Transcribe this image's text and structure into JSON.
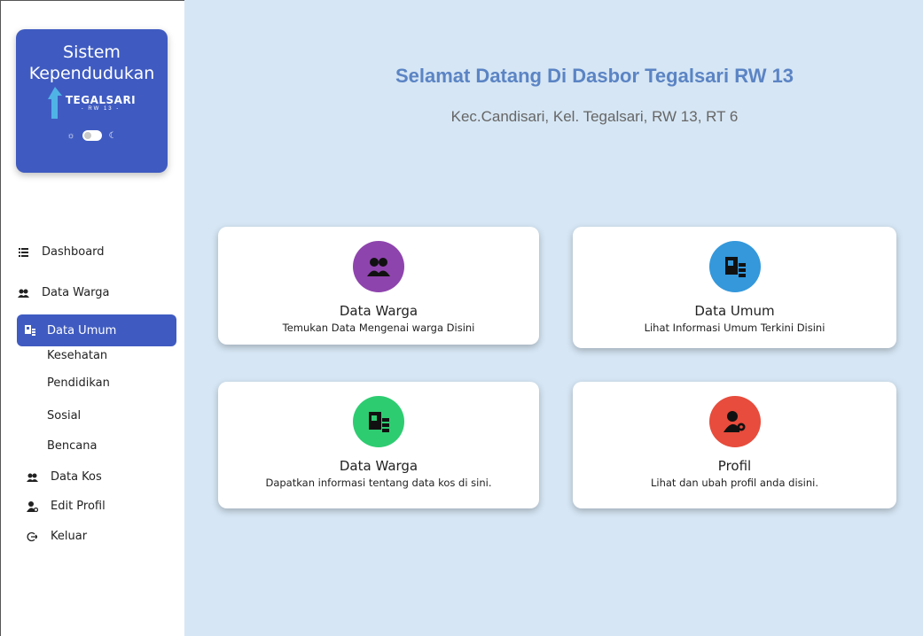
{
  "sidebar": {
    "brand": {
      "title_line1": "Sistem",
      "title_line2": "Kependudukan",
      "logo_name": "TEGALSARI",
      "logo_sub": "- RW 13 -"
    },
    "nav": {
      "dashboard": "Dashboard",
      "data_warga": "Data Warga",
      "data_umum": "Data Umum",
      "kesehatan": "Kesehatan",
      "pendidikan": "Pendidikan",
      "sosial": "Sosial",
      "bencana": "Bencana",
      "data_kos": "Data Kos",
      "edit_profil": "Edit Profil",
      "keluar": "Keluar"
    }
  },
  "main": {
    "title": "Selamat Datang Di Dasbor Tegalsari RW 13",
    "subtitle": "Kec.Candisari, Kel. Tegalsari, RW 13, RT 6"
  },
  "cards": [
    {
      "title": "Data Warga",
      "desc": "Temukan Data Mengenai warga Disini",
      "color": "#8e44ad",
      "icon": "users-icon"
    },
    {
      "title": "Data Umum",
      "desc": "Lihat Informasi Umum Terkini Disini",
      "color": "#3498db",
      "icon": "address-book-icon"
    },
    {
      "title": "Data Warga",
      "desc": "Dapatkan informasi tentang data kos di sini.",
      "color": "#2ecc71",
      "icon": "address-book-icon"
    },
    {
      "title": "Profil",
      "desc": "Lihat dan ubah profil anda disini.",
      "color": "#e74c3c",
      "icon": "user-gear-icon"
    }
  ],
  "colors": {
    "accent": "#3f5bc1",
    "title": "#5b84c4",
    "background": "#d6e6f4"
  }
}
